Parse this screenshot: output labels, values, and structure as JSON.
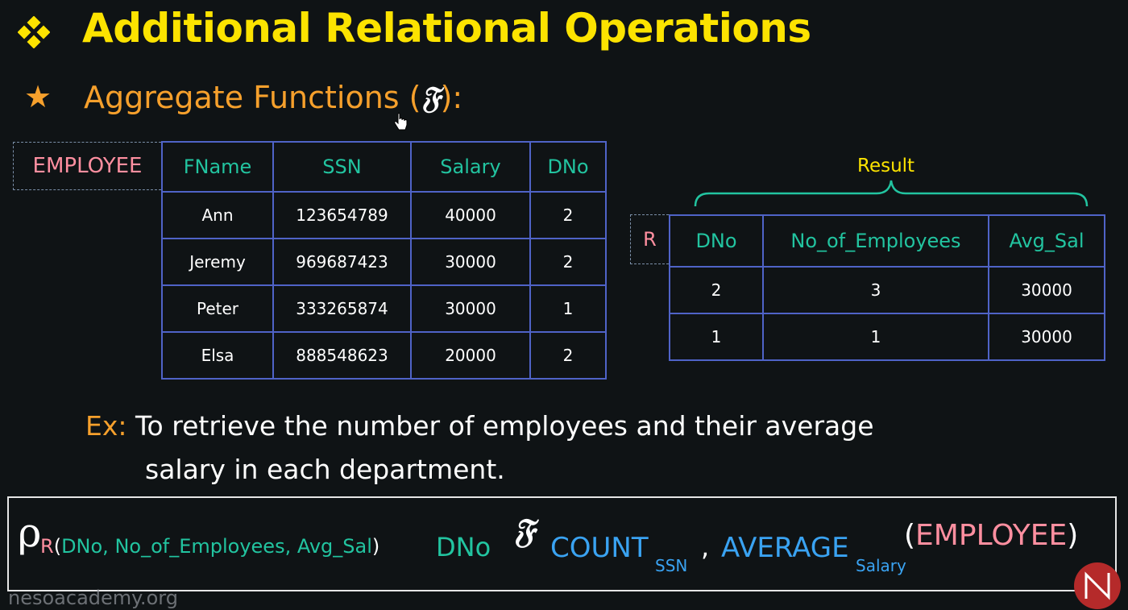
{
  "title": "Additional Relational Operations",
  "subtitle": {
    "text": "Aggregate Functions (",
    "symbol": "𝔉",
    "close": "):"
  },
  "employee_table": {
    "tag": "EMPLOYEE",
    "headers": [
      "FName",
      "SSN",
      "Salary",
      "DNo"
    ],
    "rows": [
      [
        "Ann",
        "123654789",
        "40000",
        "2"
      ],
      [
        "Jeremy",
        "969687423",
        "30000",
        "2"
      ],
      [
        "Peter",
        "333265874",
        "30000",
        "1"
      ],
      [
        "Elsa",
        "888548623",
        "20000",
        "2"
      ]
    ]
  },
  "result_table": {
    "label": "Result",
    "tag": "R",
    "headers": [
      "DNo",
      "No_of_Employees",
      "Avg_Sal"
    ],
    "rows": [
      [
        "2",
        "3",
        "30000"
      ],
      [
        "1",
        "1",
        "30000"
      ]
    ]
  },
  "example": {
    "label": "Ex:",
    "line1": "To retrieve the number of employees and their average",
    "line2": "salary in each department."
  },
  "formula": {
    "rho": "ρ",
    "rename_target": "R",
    "open_paren": "(",
    "rename_attrs": "DNo, No_of_Employees, Avg_Sal",
    "close_paren": ")",
    "group_attr": "DNo",
    "symbol": "𝔉",
    "func1": "COUNT",
    "func1_attr": "SSN",
    "comma": ",",
    "func2": "AVERAGE",
    "func2_attr": "Salary",
    "relation_open": "(",
    "relation": "EMPLOYEE",
    "relation_close": ")"
  },
  "watermark": "nesoacademy.org",
  "colors": {
    "title": "#fce300",
    "subtitle": "#f6a02c",
    "header_text": "#22c4a0",
    "table_border": "#4f63c7",
    "tag_pink": "#ff8fa0",
    "function_blue": "#3aa3f2"
  }
}
